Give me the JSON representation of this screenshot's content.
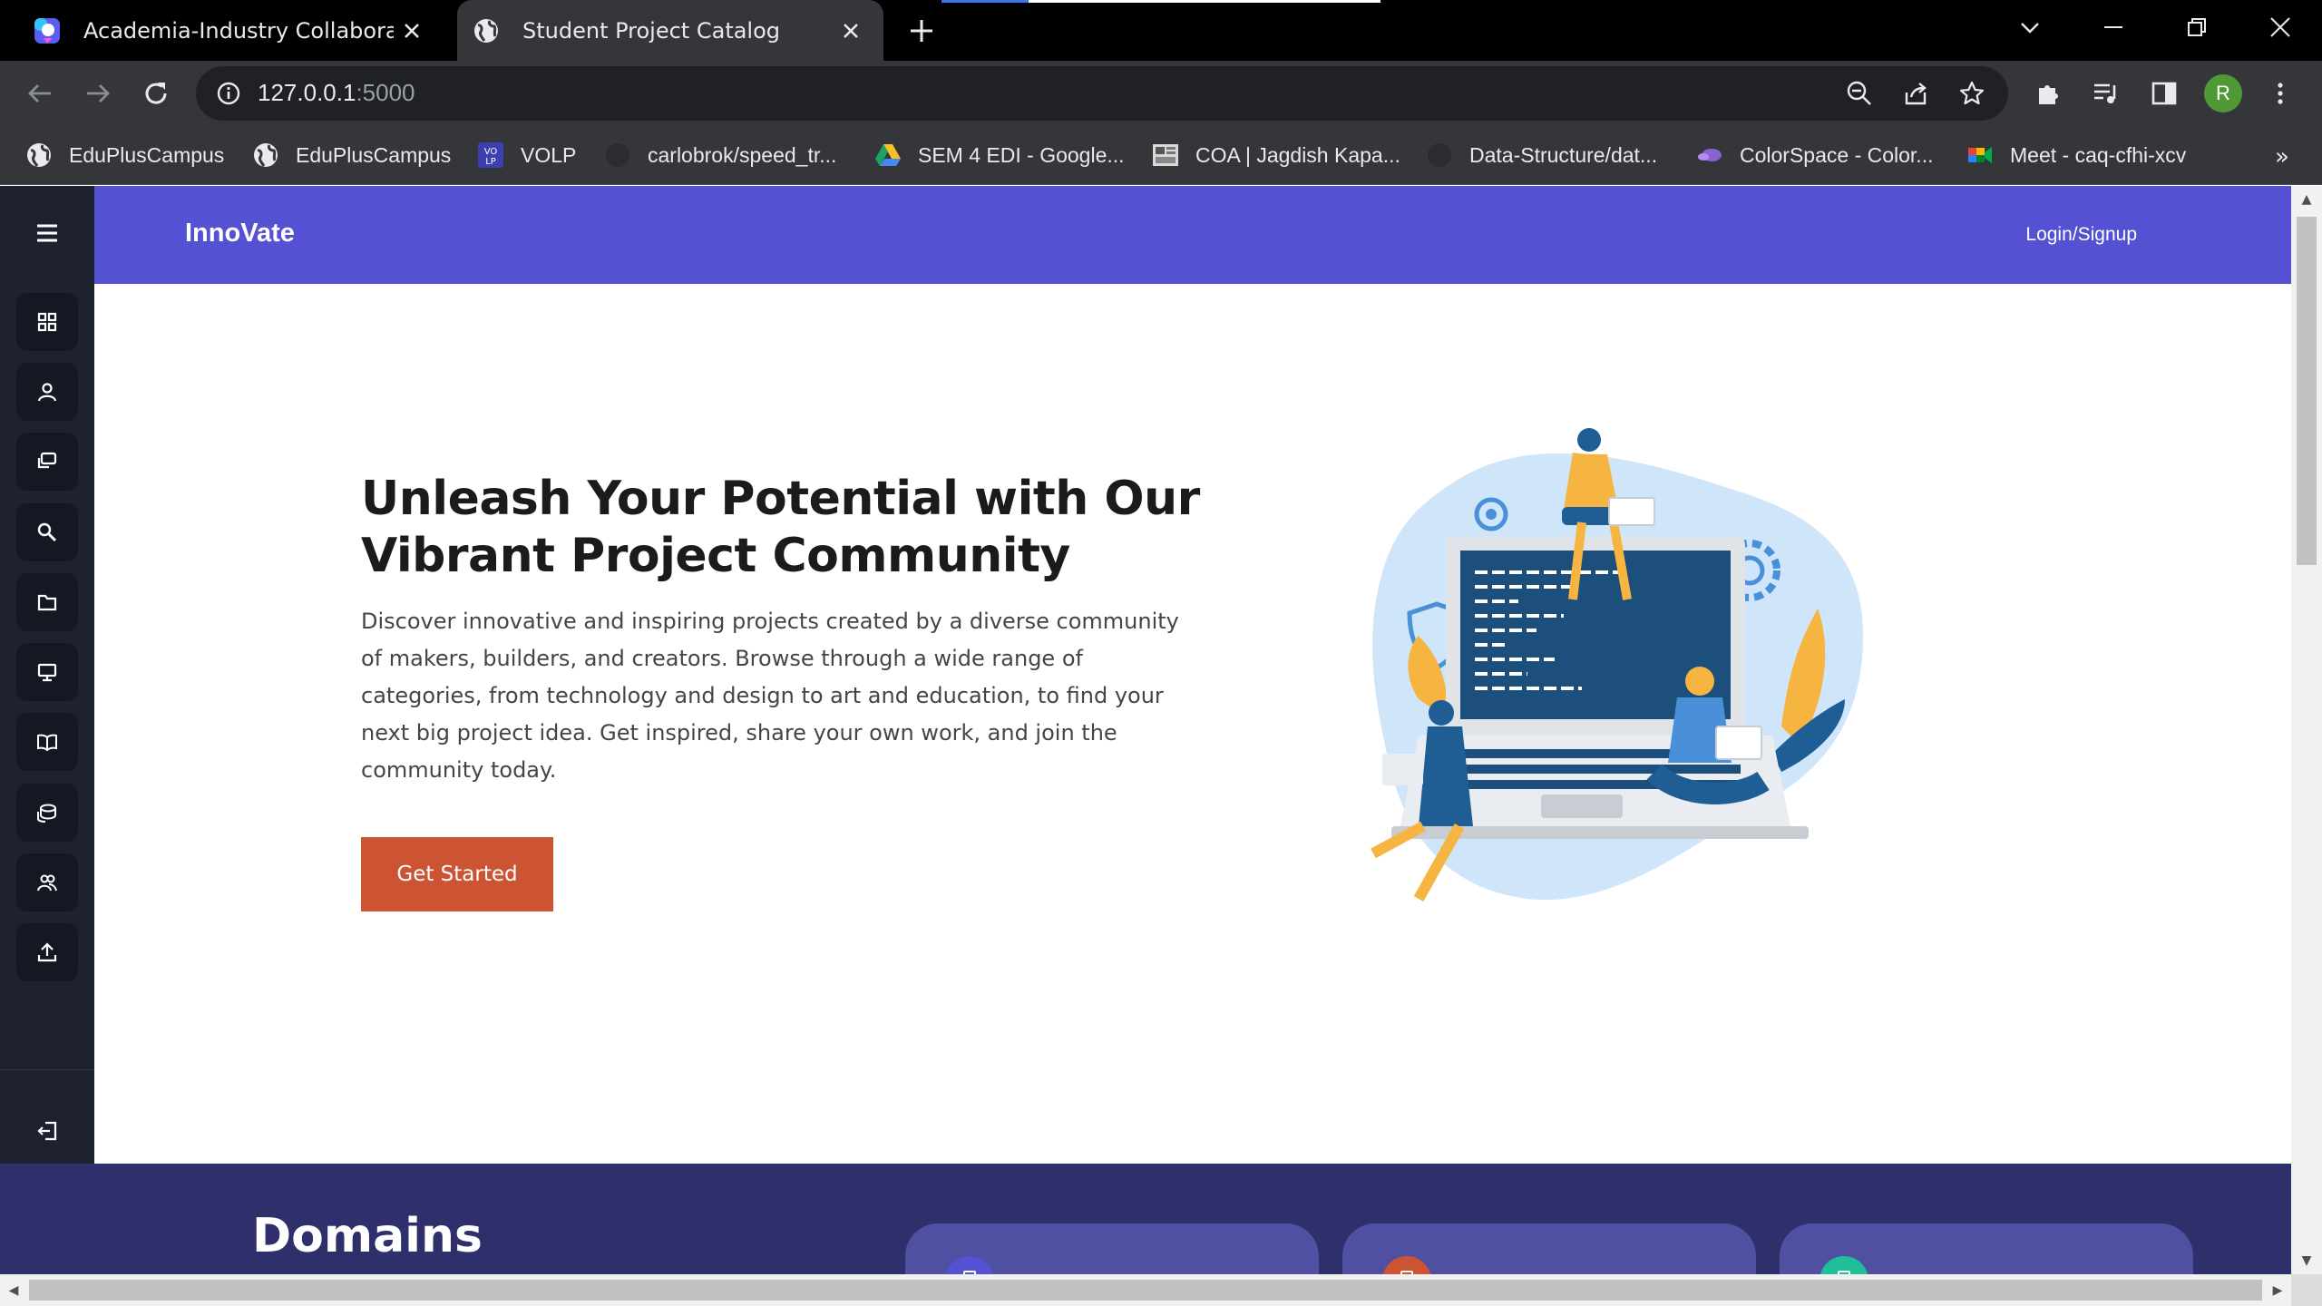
{
  "browser": {
    "tabs": [
      {
        "title": "Academia-Industry Collaboration",
        "active": false,
        "icon": "colorful-app-icon"
      },
      {
        "title": "Student Project Catalog",
        "active": true,
        "icon": "globe-icon"
      }
    ],
    "url_host": "127.0.0.1",
    "url_port": ":5000",
    "profile_initial": "R",
    "bookmarks": [
      {
        "label": "EduPlusCampus",
        "icon": "globe-icon"
      },
      {
        "label": "EduPlusCampus",
        "icon": "globe-icon"
      },
      {
        "label": "VOLP",
        "icon": "volp-icon"
      },
      {
        "label": "carlobrok/speed_tr...",
        "icon": "github-icon"
      },
      {
        "label": "SEM 4 EDI - Google...",
        "icon": "google-drive-icon"
      },
      {
        "label": "COA | Jagdish Kapa...",
        "icon": "image-icon"
      },
      {
        "label": "Data-Structure/dat...",
        "icon": "github-icon"
      },
      {
        "label": "ColorSpace - Color...",
        "icon": "colorspace-icon"
      },
      {
        "label": "Meet - caq-cfhi-xcv",
        "icon": "google-meet-icon"
      }
    ],
    "bookmarks_overflow": "»"
  },
  "navbar": {
    "brand": "InnoVate",
    "login": "Login/Signup"
  },
  "sidebar": {
    "items": [
      "dashboard-icon",
      "user-icon",
      "chat-icon",
      "search-icon",
      "folder-icon",
      "monitor-icon",
      "book-icon",
      "database-icon",
      "users-icon",
      "upload-icon"
    ],
    "logout": "logout-icon"
  },
  "hero": {
    "title": "Unleash Your Potential with Our Vibrant Project Community",
    "description": "Discover innovative and inspiring projects created by a diverse community of makers, builders, and creators. Browse through a wide range of categories, from technology and design to art and education, to find your next big project idea. Get inspired, share your own work, and join the community today.",
    "cta": "Get Started"
  },
  "domains": {
    "heading": "Domains",
    "card_colors": [
      "#5551d3",
      "#cd5432",
      "#1fbf9a"
    ]
  },
  "colors": {
    "accent": "#5551d3",
    "cta": "#cd5432",
    "sidebar": "#1d2130",
    "domains_bg": "#2f2f6b"
  }
}
